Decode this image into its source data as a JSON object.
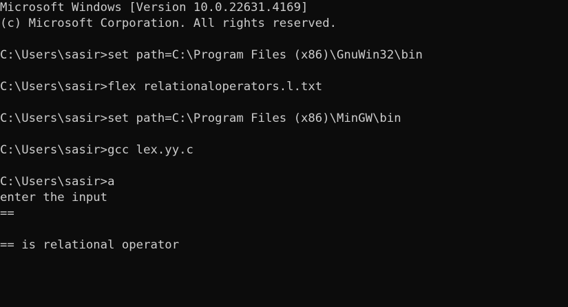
{
  "console": {
    "lines": [
      "Microsoft Windows [Version 10.0.22631.4169]",
      "(c) Microsoft Corporation. All rights reserved.",
      "",
      "C:\\Users\\sasir>set path=C:\\Program Files (x86)\\GnuWin32\\bin",
      "",
      "C:\\Users\\sasir>flex relationaloperators.l.txt",
      "",
      "C:\\Users\\sasir>set path=C:\\Program Files (x86)\\MinGW\\bin",
      "",
      "C:\\Users\\sasir>gcc lex.yy.c",
      "",
      "C:\\Users\\sasir>a",
      "enter the input",
      "==",
      "",
      "== is relational operator"
    ]
  }
}
